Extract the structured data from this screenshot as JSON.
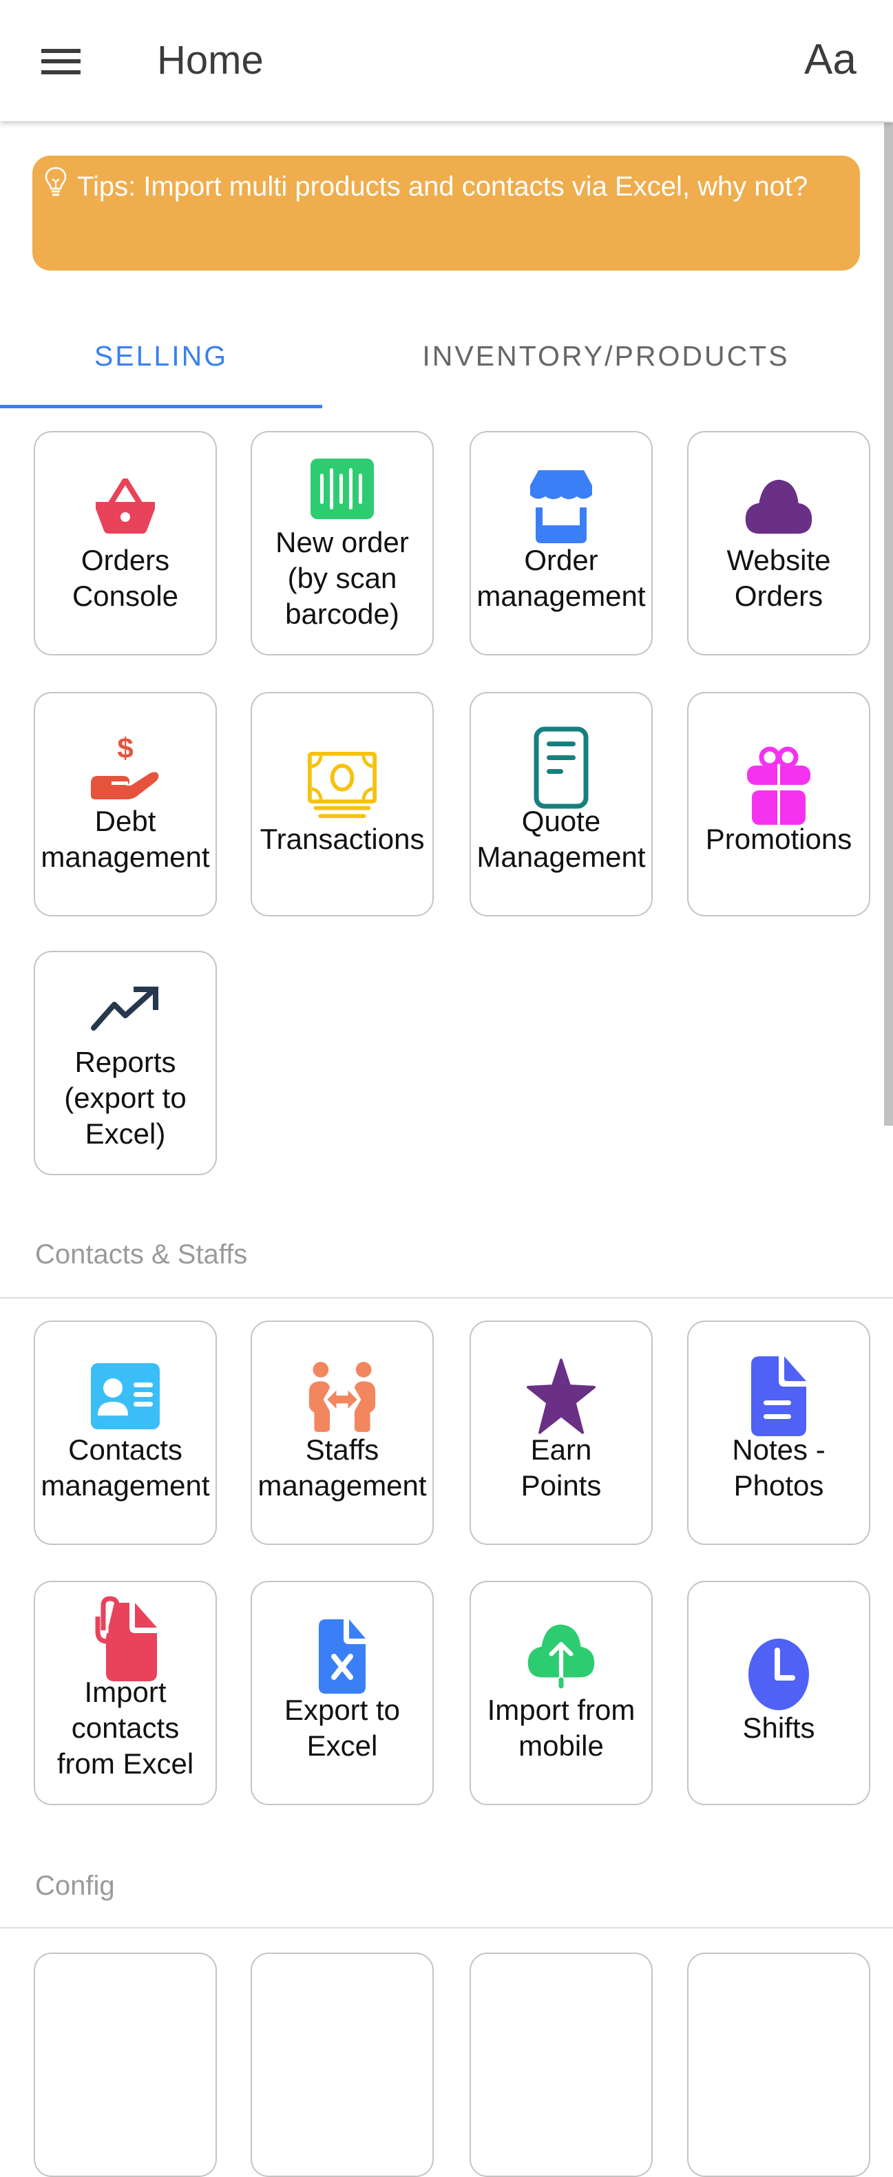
{
  "appbar": {
    "menu_icon": "hamburger-menu-icon",
    "title": "Home",
    "font_size_label": "Aa"
  },
  "tip": {
    "icon": "lightbulb-icon",
    "text": "Tips: Import multi products and contacts via Excel, why not?"
  },
  "tabs": [
    {
      "label": "SELLING",
      "active": true
    },
    {
      "label": "INVENTORY/PRODUCTS",
      "active": false
    }
  ],
  "colors": {
    "accent": "#3a80ee",
    "tip_background": "#efad4d",
    "tile_border": "#c4c4c4",
    "section_title": "#9a9a9a"
  },
  "selling": {
    "items": [
      {
        "label": "Orders\nConsole",
        "icon": "shopping-basket-icon",
        "color": "#e8435a"
      },
      {
        "label": "New order\n(by scan\nbarcode)",
        "icon": "barcode-icon",
        "color": "#2ecc71"
      },
      {
        "label": "Order\nmanagement",
        "icon": "storefront-icon",
        "color": "#3a7ff6"
      },
      {
        "label": "Website\nOrders",
        "icon": "cloud-icon",
        "color": "#6a3085"
      },
      {
        "label": "Debt\nmanagement",
        "icon": "hand-dollar-icon",
        "color": "#e5533c"
      },
      {
        "label": "Transactions",
        "icon": "banknote-icon",
        "color": "#f6c20f"
      },
      {
        "label": "Quote\nManagement",
        "icon": "document-lines-icon",
        "color": "#17807f"
      },
      {
        "label": "Promotions",
        "icon": "gift-icon",
        "color": "#f532f0"
      },
      {
        "label": "Reports\n(export to\nExcel)",
        "icon": "trending-up-icon",
        "color": "#27384d"
      }
    ]
  },
  "contacts_section": {
    "title": "Contacts & Staffs",
    "items": [
      {
        "label": "Contacts\nmanagement",
        "icon": "contact-card-icon",
        "color": "#3bbef7"
      },
      {
        "label": "Staffs\nmanagement",
        "icon": "staff-exchange-icon",
        "color": "#f2875f"
      },
      {
        "label": "Earn\nPoints",
        "icon": "star-icon",
        "color": "#6a3085"
      },
      {
        "label": "Notes -\nPhotos",
        "icon": "note-file-icon",
        "color": "#5061f6"
      },
      {
        "label": "Import\ncontacts\nfrom Excel",
        "icon": "attachment-file-icon",
        "color": "#e8435a"
      },
      {
        "label": "Export to\nExcel",
        "icon": "excel-file-icon",
        "color": "#3a7ff6"
      },
      {
        "label": "Import from\nmobile",
        "icon": "cloud-upload-icon",
        "color": "#2ecc71"
      },
      {
        "label": "Shifts",
        "icon": "clock-icon",
        "color": "#5061f6"
      }
    ]
  },
  "config_section": {
    "title": "Config"
  }
}
